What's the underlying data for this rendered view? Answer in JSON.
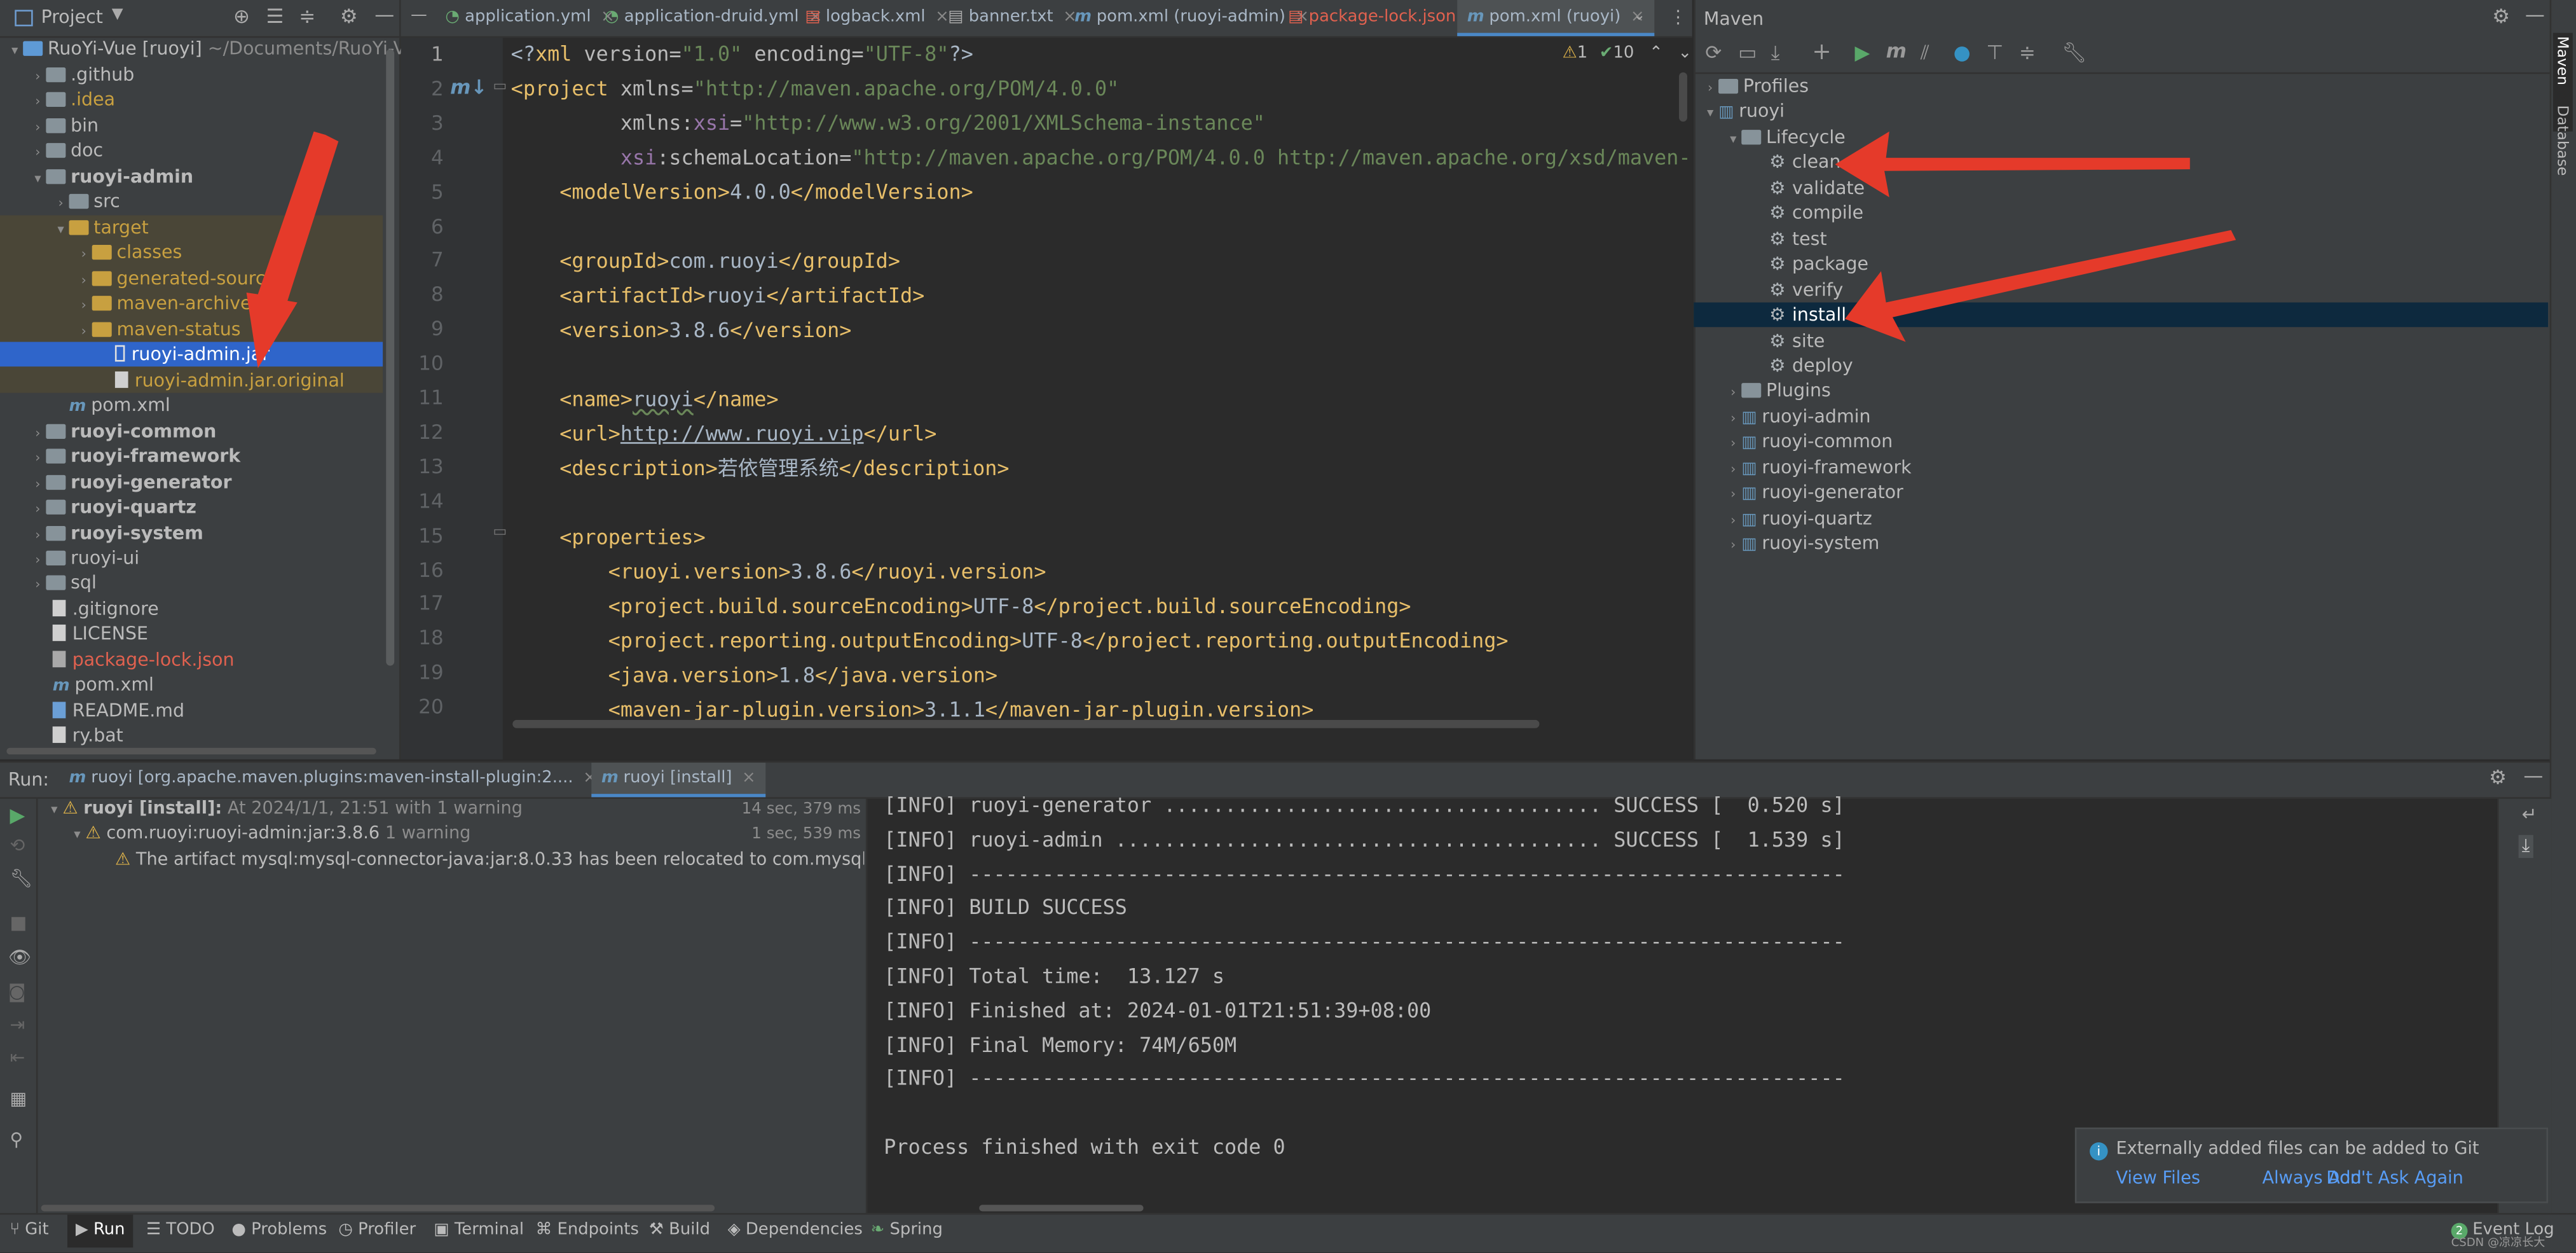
{
  "project_panel": {
    "title": "Project",
    "tree": [
      {
        "label": "RuoYi-Vue [ruoyi]",
        "extra": "~/Documents/RuoYi-Vu",
        "icon": "folder-icon"
      },
      {
        "label": ".github",
        "icon": "folder-icon"
      },
      {
        "label": ".idea",
        "icon": "folder-icon"
      },
      {
        "label": "bin",
        "icon": "folder-icon"
      },
      {
        "label": "doc",
        "icon": "folder-icon"
      },
      {
        "label": "ruoyi-admin",
        "icon": "module-folder-icon"
      },
      {
        "label": "src",
        "icon": "folder-icon"
      },
      {
        "label": "target",
        "icon": "folder-icon"
      },
      {
        "label": "classes",
        "icon": "folder-icon"
      },
      {
        "label": "generated-sources",
        "icon": "folder-icon"
      },
      {
        "label": "maven-archiver",
        "icon": "folder-icon"
      },
      {
        "label": "maven-status",
        "icon": "folder-icon"
      },
      {
        "label": "ruoyi-admin.jar",
        "icon": "jar-icon"
      },
      {
        "label": "ruoyi-admin.jar.original",
        "icon": "file-icon"
      },
      {
        "label": "pom.xml",
        "icon": "maven-file-icon"
      },
      {
        "label": "ruoyi-common",
        "icon": "module-folder-icon"
      },
      {
        "label": "ruoyi-framework",
        "icon": "module-folder-icon"
      },
      {
        "label": "ruoyi-generator",
        "icon": "module-folder-icon"
      },
      {
        "label": "ruoyi-quartz",
        "icon": "module-folder-icon"
      },
      {
        "label": "ruoyi-system",
        "icon": "module-folder-icon"
      },
      {
        "label": "ruoyi-ui",
        "icon": "folder-icon"
      },
      {
        "label": "sql",
        "icon": "folder-icon"
      },
      {
        "label": ".gitignore",
        "icon": "file-icon"
      },
      {
        "label": "LICENSE",
        "icon": "file-icon"
      },
      {
        "label": "package-lock.json",
        "icon": "json-file-icon"
      },
      {
        "label": "pom.xml",
        "icon": "maven-file-icon"
      },
      {
        "label": "README.md",
        "icon": "markdown-file-icon"
      },
      {
        "label": "ry.bat",
        "icon": "file-icon"
      }
    ]
  },
  "editor": {
    "tabs": [
      {
        "label": "application.yml"
      },
      {
        "label": "application-druid.yml"
      },
      {
        "label": "logback.xml"
      },
      {
        "label": "banner.txt"
      },
      {
        "label": "pom.xml (ruoyi-admin)"
      },
      {
        "label": "package-lock.json"
      },
      {
        "label": "pom.xml (ruoyi)"
      }
    ],
    "inspections": {
      "warnings": "1",
      "ok": "10"
    },
    "line_numbers": [
      "1",
      "2",
      "3",
      "4",
      "5",
      "6",
      "7",
      "8",
      "9",
      "10",
      "11",
      "12",
      "13",
      "14",
      "15",
      "16",
      "17",
      "18",
      "19",
      "20"
    ],
    "lines": [
      "<?xml version=\"1.0\" encoding=\"UTF-8\"?>",
      "<project xmlns=\"http://maven.apache.org/POM/4.0.0\"",
      "         xmlns:xsi=\"http://www.w3.org/2001/XMLSchema-instance\"",
      "         xsi:schemaLocation=\"http://maven.apache.org/POM/4.0.0 http://maven.apache.org/xsd/maven-",
      "    <modelVersion>4.0.0</modelVersion>",
      "",
      "    <groupId>com.ruoyi</groupId>",
      "    <artifactId>ruoyi</artifactId>",
      "    <version>3.8.6</version>",
      "",
      "    <name>ruoyi</name>",
      "    <url>http://www.ruoyi.vip</url>",
      "    <description>若依管理系统</description>",
      "",
      "    <properties>",
      "        <ruoyi.version>3.8.6</ruoyi.version>",
      "        <project.build.sourceEncoding>UTF-8</project.build.sourceEncoding>",
      "        <project.reporting.outputEncoding>UTF-8</project.reporting.outputEncoding>",
      "        <java.version>1.8</java.version>",
      "        <maven-jar-plugin.version>3.1.1</maven-jar-plugin.version>"
    ]
  },
  "maven": {
    "title": "Maven",
    "tree": [
      {
        "label": "Profiles",
        "icon": "folder-icon"
      },
      {
        "label": "ruoyi",
        "icon": "maven-module-icon"
      },
      {
        "label": "Lifecycle",
        "icon": "folder-icon"
      },
      {
        "label": "clean",
        "icon": "gear-icon"
      },
      {
        "label": "validate",
        "icon": "gear-icon"
      },
      {
        "label": "compile",
        "icon": "gear-icon"
      },
      {
        "label": "test",
        "icon": "gear-icon"
      },
      {
        "label": "package",
        "icon": "gear-icon"
      },
      {
        "label": "verify",
        "icon": "gear-icon"
      },
      {
        "label": "install",
        "icon": "gear-icon"
      },
      {
        "label": "site",
        "icon": "gear-icon"
      },
      {
        "label": "deploy",
        "icon": "gear-icon"
      },
      {
        "label": "Plugins",
        "icon": "folder-icon"
      },
      {
        "label": "ruoyi-admin",
        "icon": "maven-module-icon"
      },
      {
        "label": "ruoyi-common",
        "icon": "maven-module-icon"
      },
      {
        "label": "ruoyi-framework",
        "icon": "maven-module-icon"
      },
      {
        "label": "ruoyi-generator",
        "icon": "maven-module-icon"
      },
      {
        "label": "ruoyi-quartz",
        "icon": "maven-module-icon"
      },
      {
        "label": "ruoyi-system",
        "icon": "maven-module-icon"
      }
    ]
  },
  "run_panel": {
    "label": "Run:",
    "tabs": [
      {
        "label": "ruoyi [org.apache.maven.plugins:maven-install-plugin:2...."
      },
      {
        "label": "ruoyi [install]"
      }
    ],
    "tree": [
      {
        "label": "ruoyi [install]:",
        "detail": "At 2024/1/1, 21:51 with 1 warning",
        "time": "14 sec, 379 ms"
      },
      {
        "label": "com.ruoyi:ruoyi-admin:jar:3.8.6",
        "detail": "1 warning",
        "time": "1 sec, 539 ms"
      },
      {
        "label": "The artifact mysql:mysql-connector-java:jar:8.0.33 has been relocated to com.mysql:mysql-",
        "detail": "",
        "time": ""
      }
    ],
    "console": [
      "[INFO] ruoyi-generator .................................... SUCCESS [  0.520 s]",
      "[INFO] ruoyi-admin ........................................ SUCCESS [  1.539 s]",
      "[INFO] ------------------------------------------------------------------------",
      "[INFO] BUILD SUCCESS",
      "[INFO] ------------------------------------------------------------------------",
      "[INFO] Total time:  13.127 s",
      "[INFO] Finished at: 2024-01-01T21:51:39+08:00",
      "[INFO] Final Memory: 74M/650M",
      "[INFO] ------------------------------------------------------------------------",
      "",
      "Process finished with exit code 0"
    ]
  },
  "notification": {
    "text": "Externally added files can be added to Git",
    "actions": [
      "View Files",
      "Always Add",
      "Don't Ask Again"
    ]
  },
  "bottom_bar": {
    "items": [
      "Git",
      "Run",
      "TODO",
      "Problems",
      "Profiler",
      "Terminal",
      "Endpoints",
      "Build",
      "Dependencies",
      "Spring"
    ],
    "right": "Event Log",
    "event_count": "2",
    "watermark": "CSDN @凉凉长大"
  },
  "right_strip": [
    "Maven",
    "Database"
  ],
  "colors": {
    "selection": "#2f65ca",
    "arrow": "#e53a2a",
    "maven_selection": "#0d293e",
    "accent": "#3592c4"
  }
}
